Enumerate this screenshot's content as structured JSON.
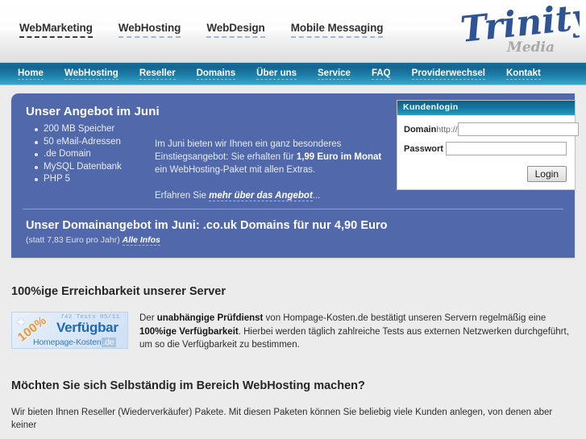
{
  "brand": {
    "name": "Trinity",
    "sub": "Media"
  },
  "topnav": {
    "items": [
      {
        "label": "WebMarketing",
        "active": true
      },
      {
        "label": "WebHosting",
        "active": false
      },
      {
        "label": "WebDesign",
        "active": false
      },
      {
        "label": "Mobile Messaging",
        "active": false
      }
    ]
  },
  "mainnav": {
    "items": [
      {
        "label": "Home"
      },
      {
        "label": "WebHosting"
      },
      {
        "label": "Reseller"
      },
      {
        "label": "Domains"
      },
      {
        "label": "Über uns"
      },
      {
        "label": "Service"
      },
      {
        "label": "FAQ"
      },
      {
        "label": "Providerwechsel"
      },
      {
        "label": "Kontakt"
      }
    ]
  },
  "promo": {
    "title": "Unser Angebot im Juni",
    "features": [
      "200 MB Speicher",
      "50 eMail-Adressen",
      ".de Domain",
      "MySQL Datenbank",
      "PHP 5"
    ],
    "paragraph_part1": "Im Juni bieten wir Ihnen ein ganz besonderes Einstiegsangebot: Sie erhalten für ",
    "paragraph_bold": "1,99 Euro im Monat",
    "paragraph_part2": " ein WebHosting-Paket mit allen Extras.",
    "more_prefix": "Erfahren Sie ",
    "more_link": "mehr über das Angebot",
    "more_suffix": "..."
  },
  "login": {
    "header": "Kundenlogin",
    "domain_label": "Domain",
    "protocol": "http://",
    "domain_value": "",
    "domain_placeholder": "",
    "password_label": "Passwort",
    "password_value": "",
    "password_placeholder": "",
    "button": "Login"
  },
  "domain_offer": {
    "title": "Unser Domainangebot im Juni: .co.uk Domains für nur 4,90 Euro",
    "sub_prefix": "(statt 7,83 Euro pro Jahr) ",
    "sub_link": "Alle Infos"
  },
  "availability": {
    "heading": "100%ige Erreichbarkeit unserer Server",
    "badge": {
      "ribbon": "100%",
      "tests": "742 Tests 05/11",
      "main": "Verfügbar",
      "sub_name": "Homepage-Kosten",
      "sub_tld": ".de"
    },
    "text_1": "Der ",
    "text_b1": "unabhängige Prüfdienst",
    "text_2": " von Hompage-Kosten.de bestätigt unseren Servern regelmäßig eine ",
    "text_b2": "100%ige Verfügbarkeit",
    "text_3": ". Hierbei werden täglich zahlreiche Tests aus externen Netzwerken durchgeführt, um so die Verfügbarkeit zu bestimmen."
  },
  "reseller": {
    "heading": "Möchten Sie sich Selbständig im Bereich WebHosting machen?",
    "text": "Wir bieten Ihnen Reseller (Wiederverkäufer) Pakete. Mit diesen Paketen können Sie beliebig viele Kunden anlegen, von denen aber keiner"
  },
  "colors": {
    "promo_blue": "#5168aa",
    "nav_teal": "#1a7ba6",
    "badge_orange": "#f0942a",
    "badge_blue": "#1c68b3",
    "page_bg": "#ececec"
  }
}
